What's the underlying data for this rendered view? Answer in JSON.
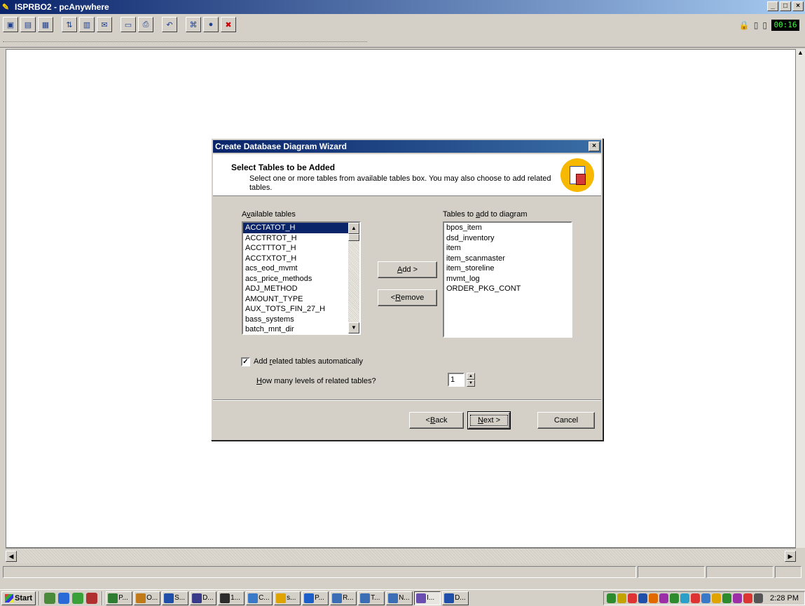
{
  "window": {
    "title": "ISPRBO2 - pcAnywhere",
    "controls": [
      "_",
      "□",
      "×"
    ]
  },
  "toolbar": {
    "buttons": [
      "view-icon",
      "file-icon",
      "properties-icon",
      "transfer-icon",
      "clipboard-icon",
      "chat-icon",
      "screen-icon",
      "print-icon",
      "undo-icon",
      "cad-icon",
      "record-icon",
      "end-session-icon"
    ],
    "timer": "00:16"
  },
  "dialog": {
    "title": "Create Database Diagram Wizard",
    "header_title": "Select Tables to be Added",
    "header_subtitle": "Select one or more tables from available tables box. You may also choose to add related tables.",
    "available_label": "Available tables",
    "available_label_mnemonic": "v",
    "available_tables": [
      "ACCTATOT_H",
      "ACCTRTOT_H",
      "ACCTTTOT_H",
      "ACCTXTOT_H",
      "acs_eod_mvmt",
      "acs_price_methods",
      "ADJ_METHOD",
      "AMOUNT_TYPE",
      "AUX_TOTS_FIN_27_H",
      "bass_systems",
      "batch_mnt_dir"
    ],
    "selected_available": "ACCTATOT_H",
    "diagram_label": "Tables to add to diagram",
    "diagram_tables": [
      "bpos_item",
      "dsd_inventory",
      "item",
      "item_scanmaster",
      "item_storeline",
      "mvmt_log",
      "ORDER_PKG_CONT"
    ],
    "add_button": "Add >",
    "remove_button": "< Remove",
    "auto_related_checked": true,
    "auto_related_label": "Add related tables automatically",
    "levels_label": "How many levels of related tables?",
    "levels_value": "1",
    "back_button": "< Back",
    "next_button": "Next >",
    "cancel_button": "Cancel"
  },
  "taskbar": {
    "start_label": "Start",
    "tasks": [
      {
        "label": "P...",
        "color": "#2f7d32"
      },
      {
        "label": "O...",
        "color": "#c07a1a"
      },
      {
        "label": "S...",
        "color": "#1f4fa8"
      },
      {
        "label": "D...",
        "color": "#3a3a8a"
      },
      {
        "label": "1...",
        "color": "#2d2d2d"
      },
      {
        "label": "C...",
        "color": "#3a78c8"
      },
      {
        "label": "s...",
        "color": "#e0a400"
      },
      {
        "label": "P...",
        "color": "#1c5fc9"
      },
      {
        "label": "R...",
        "color": "#3b6eb5"
      },
      {
        "label": "T...",
        "color": "#3b6eb5"
      },
      {
        "label": "N...",
        "color": "#3b6eb5"
      },
      {
        "label": "I...",
        "color": "#6a4fb0",
        "active": true
      },
      {
        "label": "D...",
        "color": "#1f4fa8"
      }
    ],
    "tray_colors": [
      "#2d8a2d",
      "#c2a300",
      "#d33",
      "#1f4fa8",
      "#e06a00",
      "#9c2fa8",
      "#2d8a2d",
      "#2aa0c8",
      "#d33",
      "#3a78c8",
      "#e0a400",
      "#2d8a2d",
      "#9c2fa8",
      "#d33",
      "#555"
    ],
    "clock": "2:28 PM"
  }
}
